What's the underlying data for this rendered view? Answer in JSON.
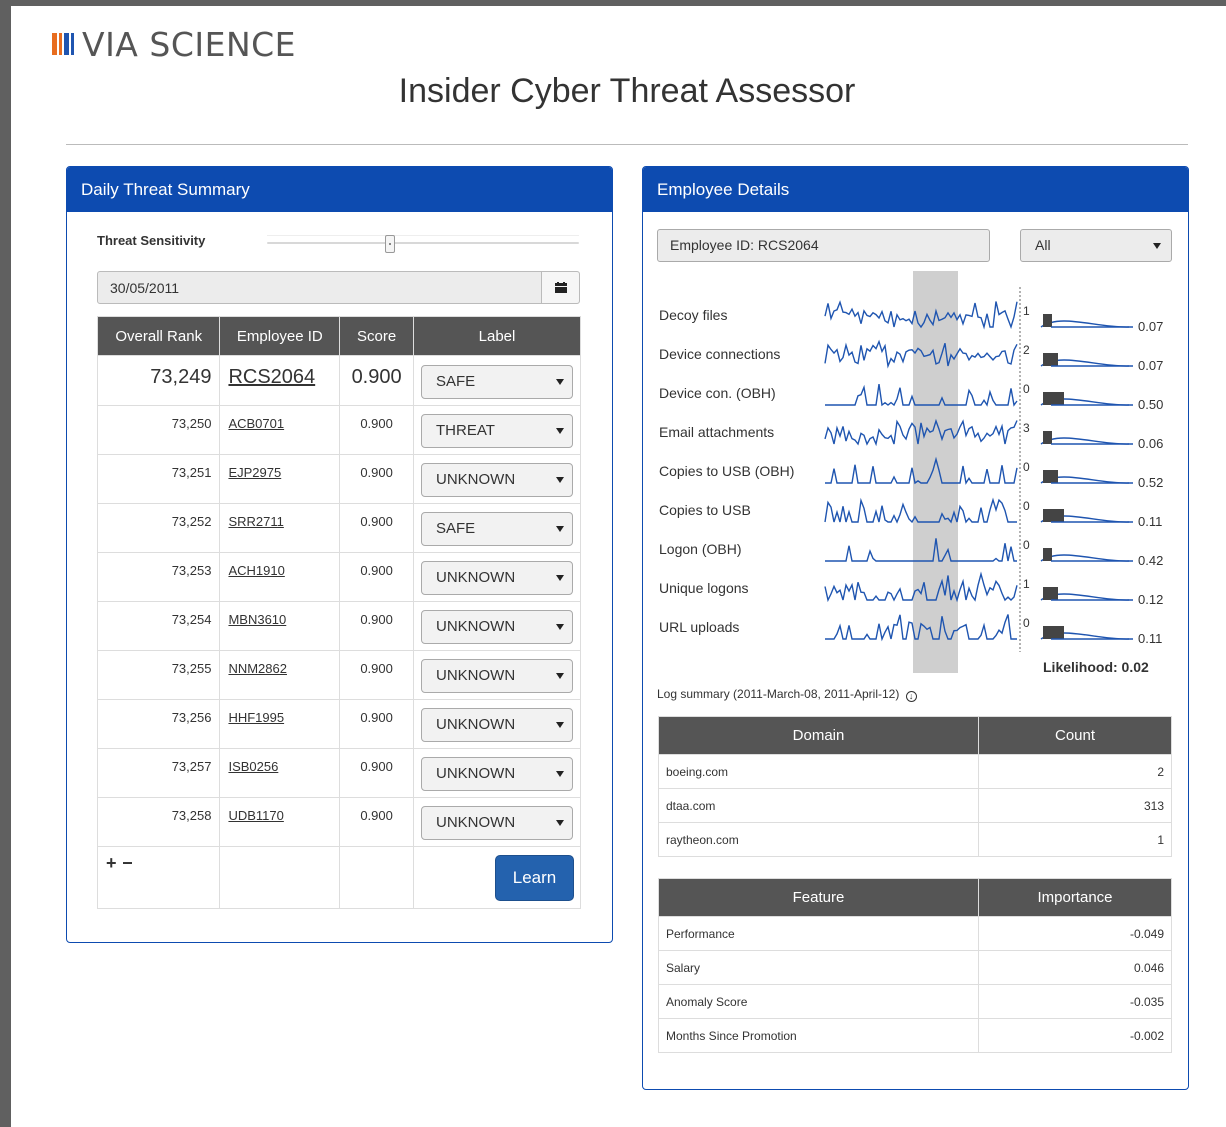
{
  "brand": {
    "name": "VIA SCIENCE",
    "mark_colors": [
      "#e86d1f",
      "#e86d1f",
      "#1f55b0",
      "#1f55b0"
    ]
  },
  "page_title": "Insider Cyber Threat Assessor",
  "colors": {
    "primary": "#0d4bb0",
    "table_header": "#555555",
    "button": "#2462ae",
    "line": "#1f55b0"
  },
  "summary_panel": {
    "title": "Daily Threat Summary",
    "sensitivity_label": "Threat Sensitivity",
    "date_value": "30/05/2011",
    "calendar_icon": "calendar-icon",
    "columns": [
      "Overall Rank",
      "Employee ID",
      "Score",
      "Label"
    ],
    "rows": [
      {
        "rank": "73,249",
        "employee_id": "RCS2064",
        "score": "0.900",
        "label": "SAFE"
      },
      {
        "rank": "73,250",
        "employee_id": "ACB0701",
        "score": "0.900",
        "label": "THREAT"
      },
      {
        "rank": "73,251",
        "employee_id": "EJP2975",
        "score": "0.900",
        "label": "UNKNOWN"
      },
      {
        "rank": "73,252",
        "employee_id": "SRR2711",
        "score": "0.900",
        "label": "SAFE"
      },
      {
        "rank": "73,253",
        "employee_id": "ACH1910",
        "score": "0.900",
        "label": "UNKNOWN"
      },
      {
        "rank": "73,254",
        "employee_id": "MBN3610",
        "score": "0.900",
        "label": "UNKNOWN"
      },
      {
        "rank": "73,255",
        "employee_id": "NNM2862",
        "score": "0.900",
        "label": "UNKNOWN"
      },
      {
        "rank": "73,256",
        "employee_id": "HHF1995",
        "score": "0.900",
        "label": "UNKNOWN"
      },
      {
        "rank": "73,257",
        "employee_id": "ISB0256",
        "score": "0.900",
        "label": "UNKNOWN"
      },
      {
        "rank": "73,258",
        "employee_id": "UDB1170",
        "score": "0.900",
        "label": "UNKNOWN"
      }
    ],
    "plus_label": "+",
    "minus_label": "−",
    "learn_label": "Learn"
  },
  "details_panel": {
    "title": "Employee Details",
    "employee_id_text": "Employee ID: RCS2064",
    "filter_value": "All",
    "features": [
      {
        "name": "Decoy files",
        "current": "1",
        "value": "0.07"
      },
      {
        "name": "Device connections",
        "current": "2",
        "value": "0.07"
      },
      {
        "name": "Device con. (OBH)",
        "current": "0",
        "value": "0.50"
      },
      {
        "name": "Email attachments",
        "current": "3",
        "value": "0.06"
      },
      {
        "name": "Copies to USB (OBH)",
        "current": "0",
        "value": "0.52"
      },
      {
        "name": "Copies to USB",
        "current": "0",
        "value": "0.11"
      },
      {
        "name": "Logon (OBH)",
        "current": "0",
        "value": "0.42"
      },
      {
        "name": "Unique logons",
        "current": "1",
        "value": "0.12"
      },
      {
        "name": "URL uploads",
        "current": "0",
        "value": "0.11"
      }
    ],
    "likelihood": "Likelihood: 0.02",
    "log_summary": "Log summary (2011-March-08, 2011-April-12)",
    "domain_columns": [
      "Domain",
      "Count"
    ],
    "domains": [
      {
        "domain": "boeing.com",
        "count": "2"
      },
      {
        "domain": "dtaa.com",
        "count": "313"
      },
      {
        "domain": "raytheon.com",
        "count": "1"
      }
    ],
    "importance_columns": [
      "Feature",
      "Importance"
    ],
    "importances": [
      {
        "feature": "Performance",
        "importance": "-0.049"
      },
      {
        "feature": "Salary",
        "importance": "0.046"
      },
      {
        "feature": "Anomaly Score",
        "importance": "-0.035"
      },
      {
        "feature": "Months Since Promotion",
        "importance": "-0.002"
      }
    ]
  }
}
